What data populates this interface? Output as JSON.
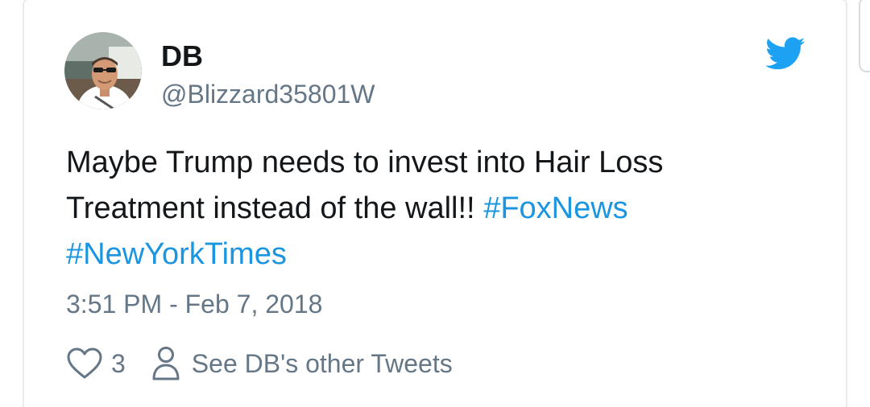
{
  "tweet": {
    "author": {
      "display_name": "DB",
      "handle": "@Blizzard35801W"
    },
    "text_parts": {
      "line1": "Maybe Trump needs to invest into Hair Loss",
      "line2": "Treatment instead of the wall!!",
      "hashtag1": "#FoxNews",
      "hashtag2": "#NewYorkTimes"
    },
    "timestamp": "3:51 PM - Feb 7, 2018",
    "like_count": "3",
    "other_tweets_label": "See DB's other Tweets"
  },
  "icons": {
    "brand": "twitter-bird-icon",
    "like": "heart-icon",
    "profile": "person-icon"
  },
  "colors": {
    "hashtag": "#1b95e0",
    "brand": "#1da1f2",
    "secondary_text": "#657786",
    "primary_text": "#14171a"
  }
}
